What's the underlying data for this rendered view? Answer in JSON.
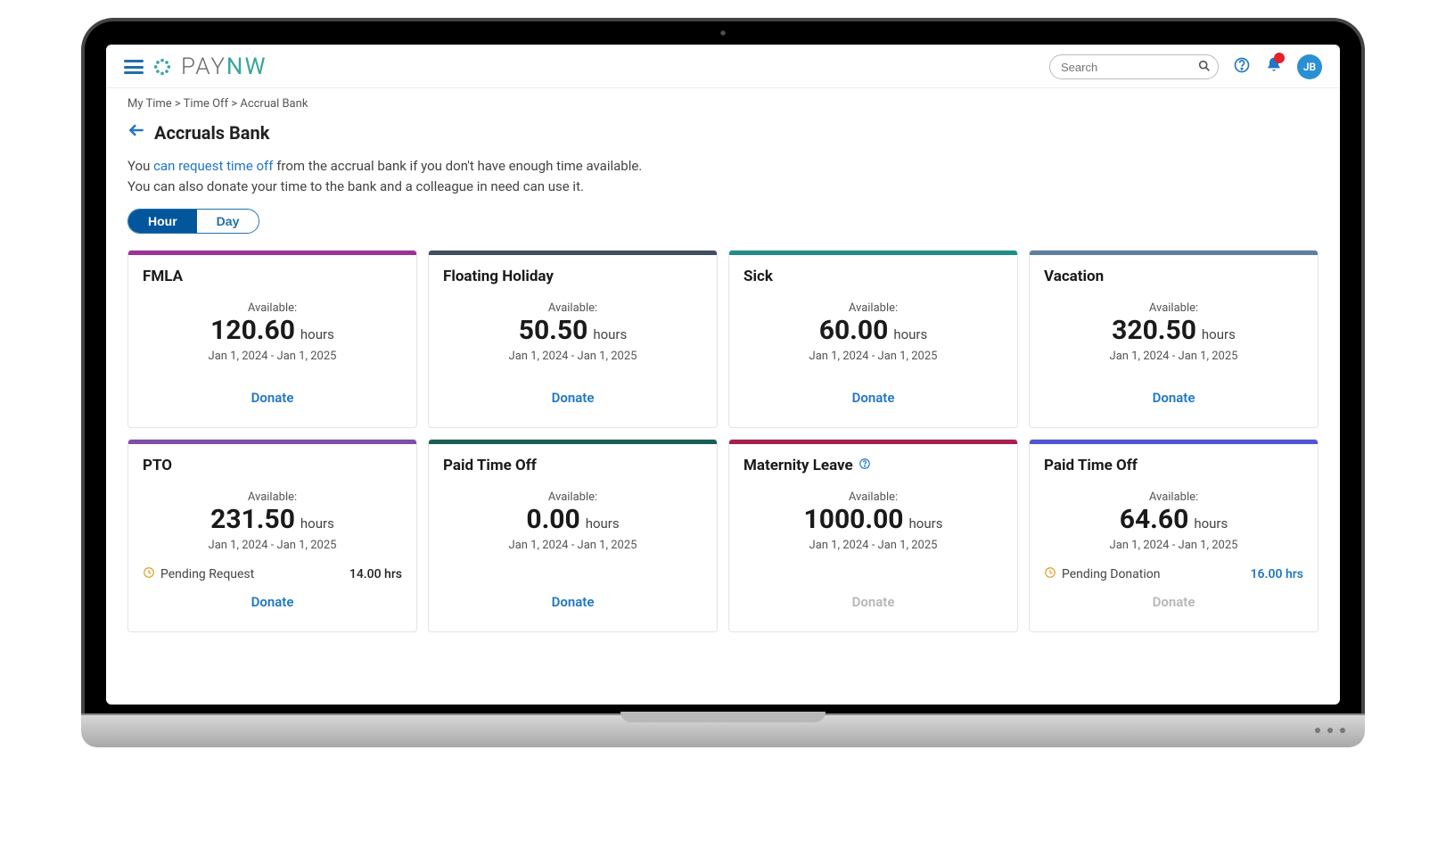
{
  "header": {
    "brand_pay": "PAY",
    "brand_nw": "NW",
    "search_placeholder": "Search",
    "avatar_initials": "JB"
  },
  "breadcrumb": "My Time > Time Off > Accrual Bank",
  "page_title": "Accruals Bank",
  "intro": {
    "pre": "You ",
    "link": "can request time off",
    "post": " from the accrual bank if you don't have enough time available.",
    "line2": "You can also donate your time to the bank and a colleague in need can use it."
  },
  "toggle": {
    "hour": "Hour",
    "day": "Day"
  },
  "labels": {
    "available": "Available:",
    "hours": "hours",
    "donate": "Donate",
    "pending_request": "Pending Request",
    "pending_donation": "Pending Donation"
  },
  "colors": {
    "fmla": "#9f3393",
    "floating": "#3e4f63",
    "sick": "#1f8e8a",
    "vacation": "#5e7ea3",
    "pto": "#7e4ea8",
    "paid1": "#195f56",
    "maternity": "#a9204c",
    "paid2": "#5055d3"
  },
  "cards": [
    {
      "id": "fmla",
      "title": "FMLA",
      "value": "120.60",
      "period": "Jan 1, 2024 - Jan 1, 2025",
      "donate_enabled": true
    },
    {
      "id": "floating",
      "title": "Floating Holiday",
      "value": "50.50",
      "period": "Jan 1, 2024 - Jan 1, 2025",
      "donate_enabled": true
    },
    {
      "id": "sick",
      "title": "Sick",
      "value": "60.00",
      "period": "Jan 1, 2024 - Jan 1, 2025",
      "donate_enabled": true
    },
    {
      "id": "vacation",
      "title": "Vacation",
      "value": "320.50",
      "period": "Jan 1, 2024 - Jan 1, 2025",
      "donate_enabled": true
    },
    {
      "id": "pto",
      "title": "PTO",
      "value": "231.50",
      "period": "Jan 1, 2024 - Jan 1, 2025",
      "donate_enabled": true,
      "pending_type": "request",
      "pending_value": "14.00 hrs"
    },
    {
      "id": "paid1",
      "title": "Paid Time Off",
      "value": "0.00",
      "period": "Jan 1, 2024 - Jan 1, 2025",
      "donate_enabled": true
    },
    {
      "id": "maternity",
      "title": "Maternity Leave",
      "value": "1000.00",
      "period": "Jan 1, 2024 - Jan 1, 2025",
      "donate_enabled": false,
      "help": true
    },
    {
      "id": "paid2",
      "title": "Paid Time Off",
      "value": "64.60",
      "period": "Jan 1, 2024 - Jan 1, 2025",
      "donate_enabled": false,
      "pending_type": "donation",
      "pending_value": "16.00 hrs"
    }
  ]
}
